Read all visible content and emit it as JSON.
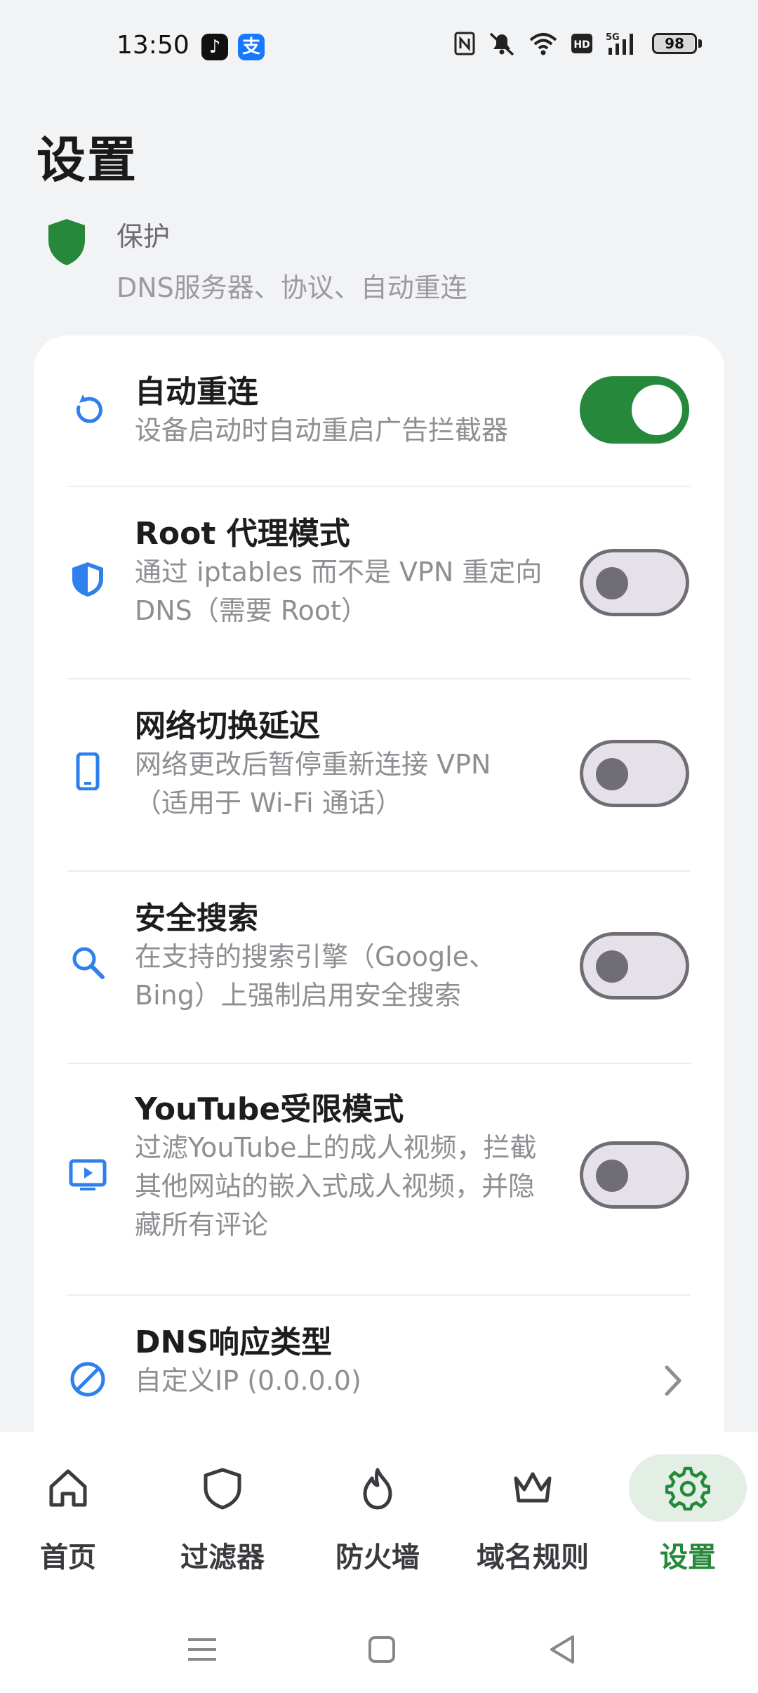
{
  "status_bar": {
    "time": "13:50",
    "battery": "98",
    "battery_level": 0.98,
    "icons": [
      "tiktok-icon",
      "alipay-icon",
      "nfc-icon",
      "mute-icon",
      "wifi-icon",
      "hd-icon",
      "signal-5g-icon",
      "battery-icon"
    ]
  },
  "page": {
    "title": "设置"
  },
  "section": {
    "title": "保护",
    "subtitle": "DNS服务器、协议、自动重连",
    "icon": "shield-icon"
  },
  "settings": [
    {
      "title": "自动重连",
      "desc": [
        "设备启动时自动重启广告拦截器"
      ],
      "icon": "refresh-icon",
      "control": "toggle",
      "enabled": true
    },
    {
      "title": "Root 代理模式",
      "desc": [
        "通过 iptables 而不是 VPN 重定向",
        "DNS（需要 Root）"
      ],
      "icon": "shield-half-icon",
      "control": "toggle",
      "enabled": false
    },
    {
      "title": "网络切换延迟",
      "desc": [
        "网络更改后暂停重新连接 VPN",
        "（适用于 Wi-Fi 通话）"
      ],
      "icon": "phone-icon",
      "control": "toggle",
      "enabled": false
    },
    {
      "title": "安全搜索",
      "desc": [
        "在支持的搜索引擎（Google、",
        "Bing）上强制启用安全搜索"
      ],
      "icon": "search-icon",
      "control": "toggle",
      "enabled": false
    },
    {
      "title": "YouTube受限模式",
      "desc": [
        "过滤YouTube上的成人视频，拦截",
        "其他网站的嵌入式成人视频，并隐",
        "藏所有评论"
      ],
      "icon": "tv-play-icon",
      "control": "toggle",
      "enabled": false
    },
    {
      "title": "DNS响应类型",
      "desc": [
        "自定义IP (0.0.0.0)"
      ],
      "icon": "block-icon",
      "control": "chevron"
    }
  ],
  "bottom_nav": {
    "items": [
      {
        "label": "首页",
        "icon": "home-icon",
        "active": false
      },
      {
        "label": "过滤器",
        "icon": "shield-outline-icon",
        "active": false
      },
      {
        "label": "防火墙",
        "icon": "flame-icon",
        "active": false
      },
      {
        "label": "域名规则",
        "icon": "crown-icon",
        "active": false
      },
      {
        "label": "设置",
        "icon": "gear-icon",
        "active": true
      }
    ]
  },
  "colors": {
    "accent": "#26883a",
    "icon_blue": "#2f80ed",
    "background": "#f2f3f5"
  }
}
